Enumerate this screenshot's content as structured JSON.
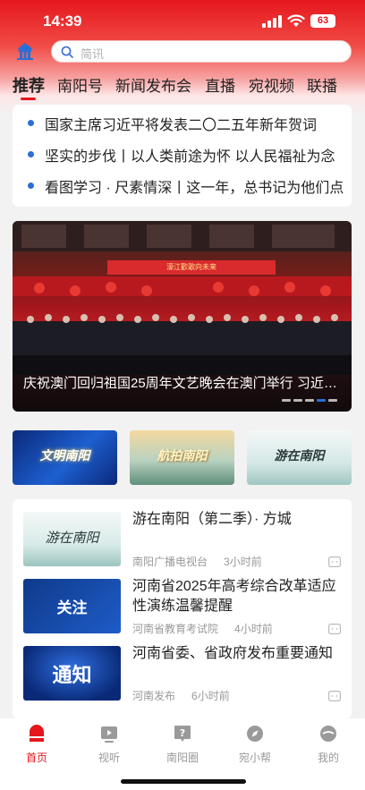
{
  "status": {
    "time": "14:39",
    "battery": "63"
  },
  "search": {
    "placeholder": "简讯"
  },
  "tabs": [
    {
      "label": "推荐",
      "active": true
    },
    {
      "label": "南阳号"
    },
    {
      "label": "新闻发布会"
    },
    {
      "label": "直播"
    },
    {
      "label": "宛视频"
    },
    {
      "label": "联播"
    }
  ],
  "headlines": [
    "国家主席习近平将发表二〇二五年新年贺词",
    "坚实的步伐丨以人类前途为怀  以人民福祉为念",
    "看图学习 · 尺素情深丨这一年，总书记为他们点"
  ],
  "banner": {
    "sign_text": "濠江歡歌向未来",
    "caption": "庆祝澳门回归祖国25周年文艺晚会在澳门举行  习近平出席",
    "slide_count": 5,
    "active_slide": 4
  },
  "thumbs": [
    {
      "text": "文明南阳",
      "color": "#ffffff"
    },
    {
      "text": "航拍南阳",
      "color": "#ffe9a8"
    },
    {
      "text": "游在南阳",
      "color": "#2a3a3a"
    }
  ],
  "feed": [
    {
      "title": "游在南阳（第二季）· 方城",
      "source": "南阳广播电视台",
      "time": "3小时前",
      "thumb_text": "游在南阳"
    },
    {
      "title": "河南省2025年高考综合改革适应性演练温馨提醒",
      "source": "河南省教育考试院",
      "time": "4小时前",
      "thumb_text": "关注"
    },
    {
      "title": "河南省委、省政府发布重要通知",
      "source": "河南发布",
      "time": "6小时前",
      "thumb_text": "通知"
    }
  ],
  "tabbar": [
    {
      "label": "首页",
      "icon": "home-icon",
      "active": true
    },
    {
      "label": "视听",
      "icon": "play-icon"
    },
    {
      "label": "南阳圈",
      "icon": "question-icon"
    },
    {
      "label": "宛小帮",
      "icon": "compass-icon"
    },
    {
      "label": "我的",
      "icon": "profile-icon"
    }
  ],
  "colors": {
    "brand_red": "#e5171d",
    "bullet_blue": "#2a6fd6"
  }
}
